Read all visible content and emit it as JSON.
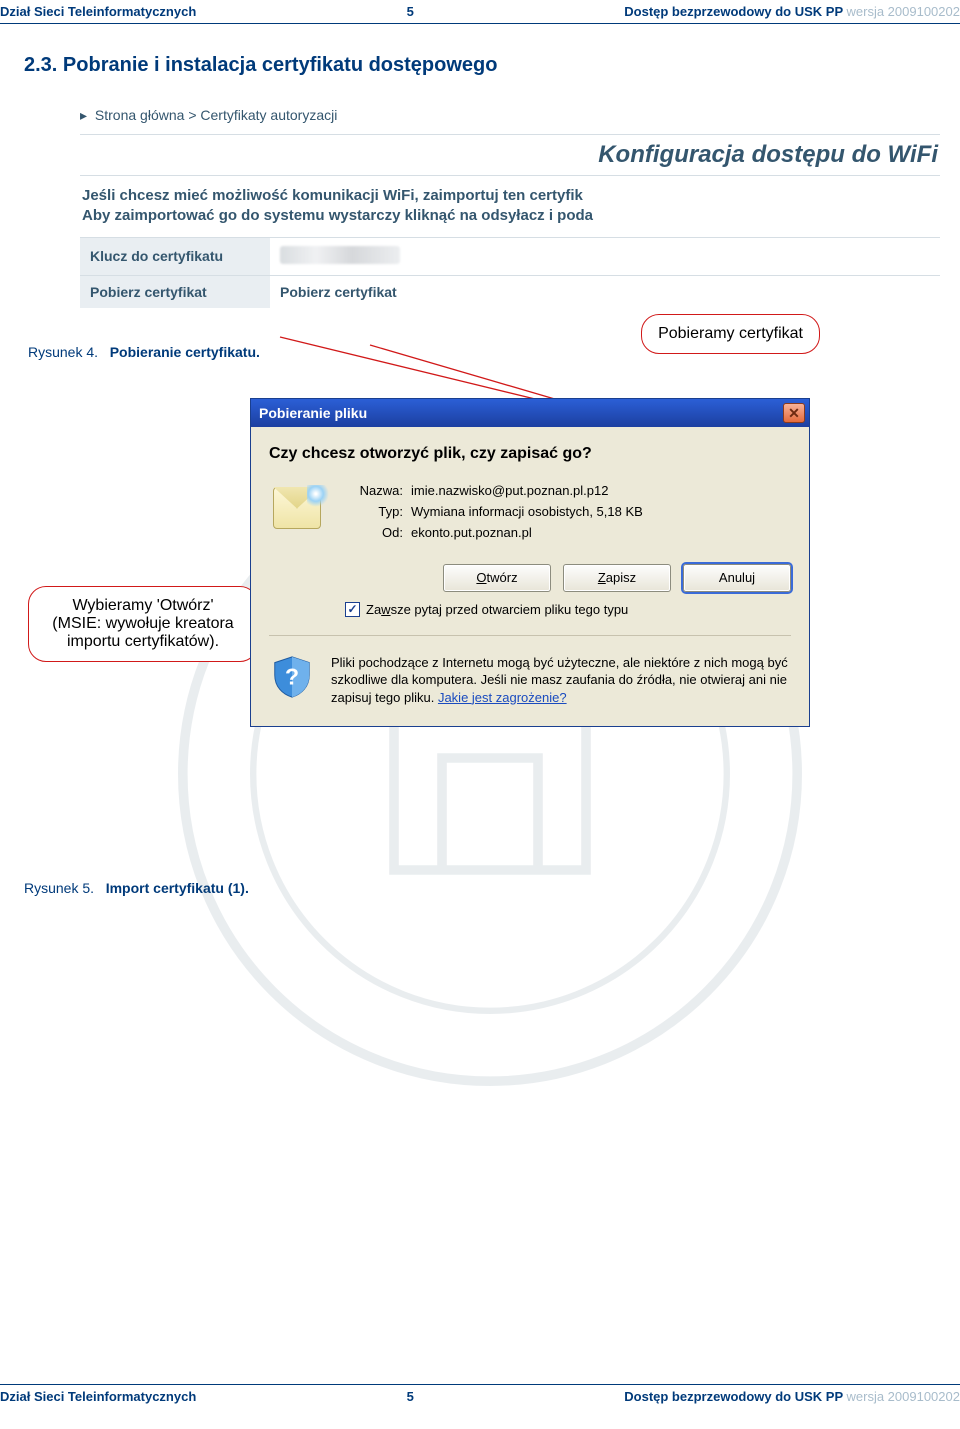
{
  "header": {
    "left": "Dział Sieci Teleinformatycznych",
    "mid": "5",
    "right_main": "Dostęp bezprzewodowy do USK PP ",
    "right_faded": "wersja 2009100202"
  },
  "section_title": "2.3. Pobranie i instalacja certyfikatu dostępowego",
  "shot1": {
    "breadcrumb_home": "Strona główna",
    "breadcrumb_sep": " > ",
    "breadcrumb_current": "Certyfikaty autoryzacji",
    "heading": "Konfiguracja dostępu do WiFi",
    "info_line1": "Jeśli chcesz mieć możliwość komunikacji WiFi, zaimportuj ten certyfik",
    "info_line2": "Aby zaimportować go do systemu wystarczy kliknąć na odsyłacz i poda",
    "row_key_label": "Klucz do certyfikatu",
    "row_dl_label": "Pobierz certyfikat",
    "row_dl_link": "Pobierz certyfikat"
  },
  "callout1_text": "Pobieramy certyfikat",
  "caption4_num": "Rysunek 4.",
  "caption4_text": "Pobieranie certyfikatu.",
  "callout2_line1": "Wybieramy 'Otwórz'",
  "callout2_line2": "(MSIE: wywołuje kreatora",
  "callout2_line3": "importu certyfikatów).",
  "dialog": {
    "title": "Pobieranie pliku",
    "question": "Czy chcesz otworzyć plik, czy zapisać go?",
    "meta_name_k": "Nazwa:",
    "meta_name_v": "imie.nazwisko@put.poznan.pl.p12",
    "meta_type_k": "Typ:",
    "meta_type_v": "Wymiana informacji osobistych, 5,18 KB",
    "meta_from_k": "Od:",
    "meta_from_v": "ekonto.put.poznan.pl",
    "btn_open_pre": "",
    "btn_open_u": "O",
    "btn_open_post": "twórz",
    "btn_save_pre": "",
    "btn_save_u": "Z",
    "btn_save_post": "apisz",
    "btn_cancel": "Anuluj",
    "check_label_pre": "Za",
    "check_label_u": "w",
    "check_label_post": "sze pytaj przed otwarciem pliku tego typu",
    "warn_text": "Pliki pochodzące z Internetu mogą być użyteczne, ale niektóre z nich mogą być szkodliwe dla komputera. Jeśli nie masz zaufania do źródła, nie otwieraj ani nie zapisuj tego pliku. ",
    "warn_link": "Jakie jest zagrożenie?"
  },
  "caption5_num": "Rysunek 5.",
  "caption5_text": "Import certyfikatu (1).",
  "footer": {
    "left": "Dział Sieci Teleinformatycznych",
    "mid": "5",
    "right_main": "Dostęp bezprzewodowy do USK PP ",
    "right_faded": "wersja 2009100202"
  }
}
